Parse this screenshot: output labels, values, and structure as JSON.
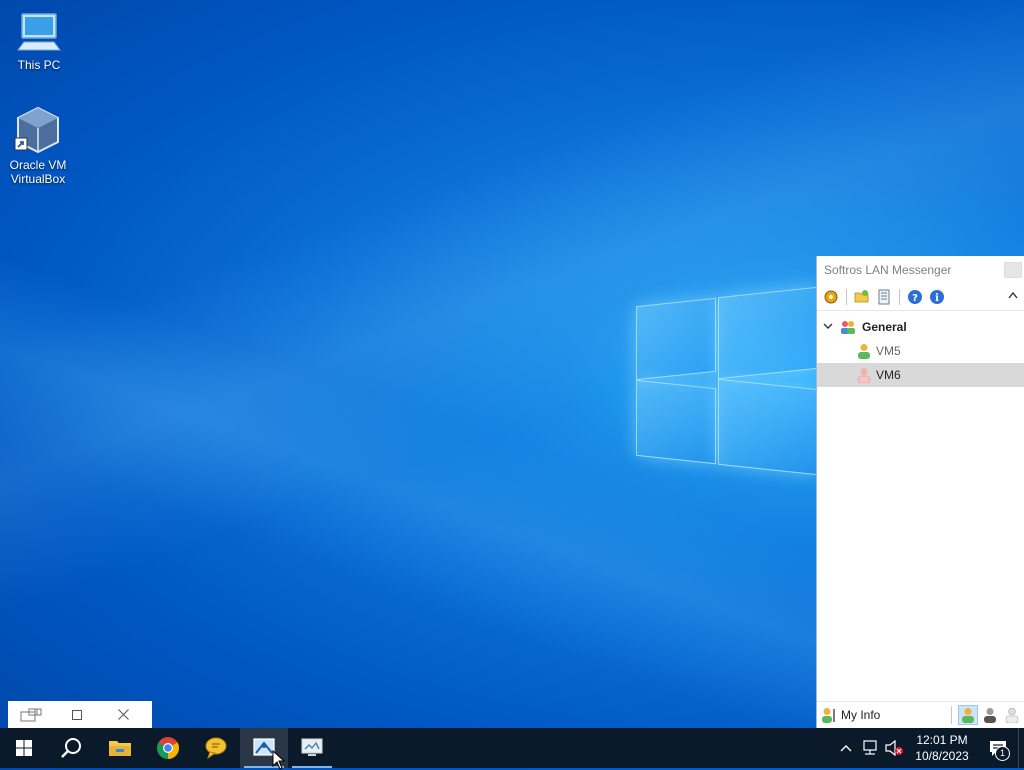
{
  "desktop": {
    "icons": [
      {
        "label": "This PC",
        "icon": "computer-icon"
      },
      {
        "label": "Oracle VM VirtualBox",
        "icon": "virtualbox-icon"
      }
    ]
  },
  "messenger": {
    "title": "Softros LAN Messenger",
    "toolbar": [
      {
        "icon": "settings-gear-icon"
      },
      {
        "icon": "open-folder-icon"
      },
      {
        "icon": "message-history-icon"
      },
      {
        "icon": "help-icon"
      },
      {
        "icon": "info-icon"
      }
    ],
    "group": {
      "label": "General"
    },
    "users": [
      {
        "label": "VM5",
        "status": "online",
        "selected": false
      },
      {
        "label": "VM6",
        "status": "away",
        "selected": true
      }
    ],
    "status_bar": {
      "my_info_label": "My Info",
      "statuses": [
        "online",
        "busy",
        "offline"
      ],
      "active_status": "online"
    }
  },
  "taskbar": {
    "items": [
      {
        "icon": "start-windows-icon"
      },
      {
        "icon": "search-icon"
      },
      {
        "icon": "file-explorer-icon"
      },
      {
        "icon": "chrome-icon"
      },
      {
        "icon": "messenger-chat-icon"
      },
      {
        "icon": "snipping-tool-icon"
      },
      {
        "icon": "remote-desktop-icon"
      }
    ],
    "tray": {
      "time": "12:01 PM",
      "date": "10/8/2023",
      "notification_count": "1"
    }
  },
  "colors": {
    "taskbar": "#0b1a2b",
    "selection": "#d9d9d9",
    "active_status": "#cce4f7"
  }
}
